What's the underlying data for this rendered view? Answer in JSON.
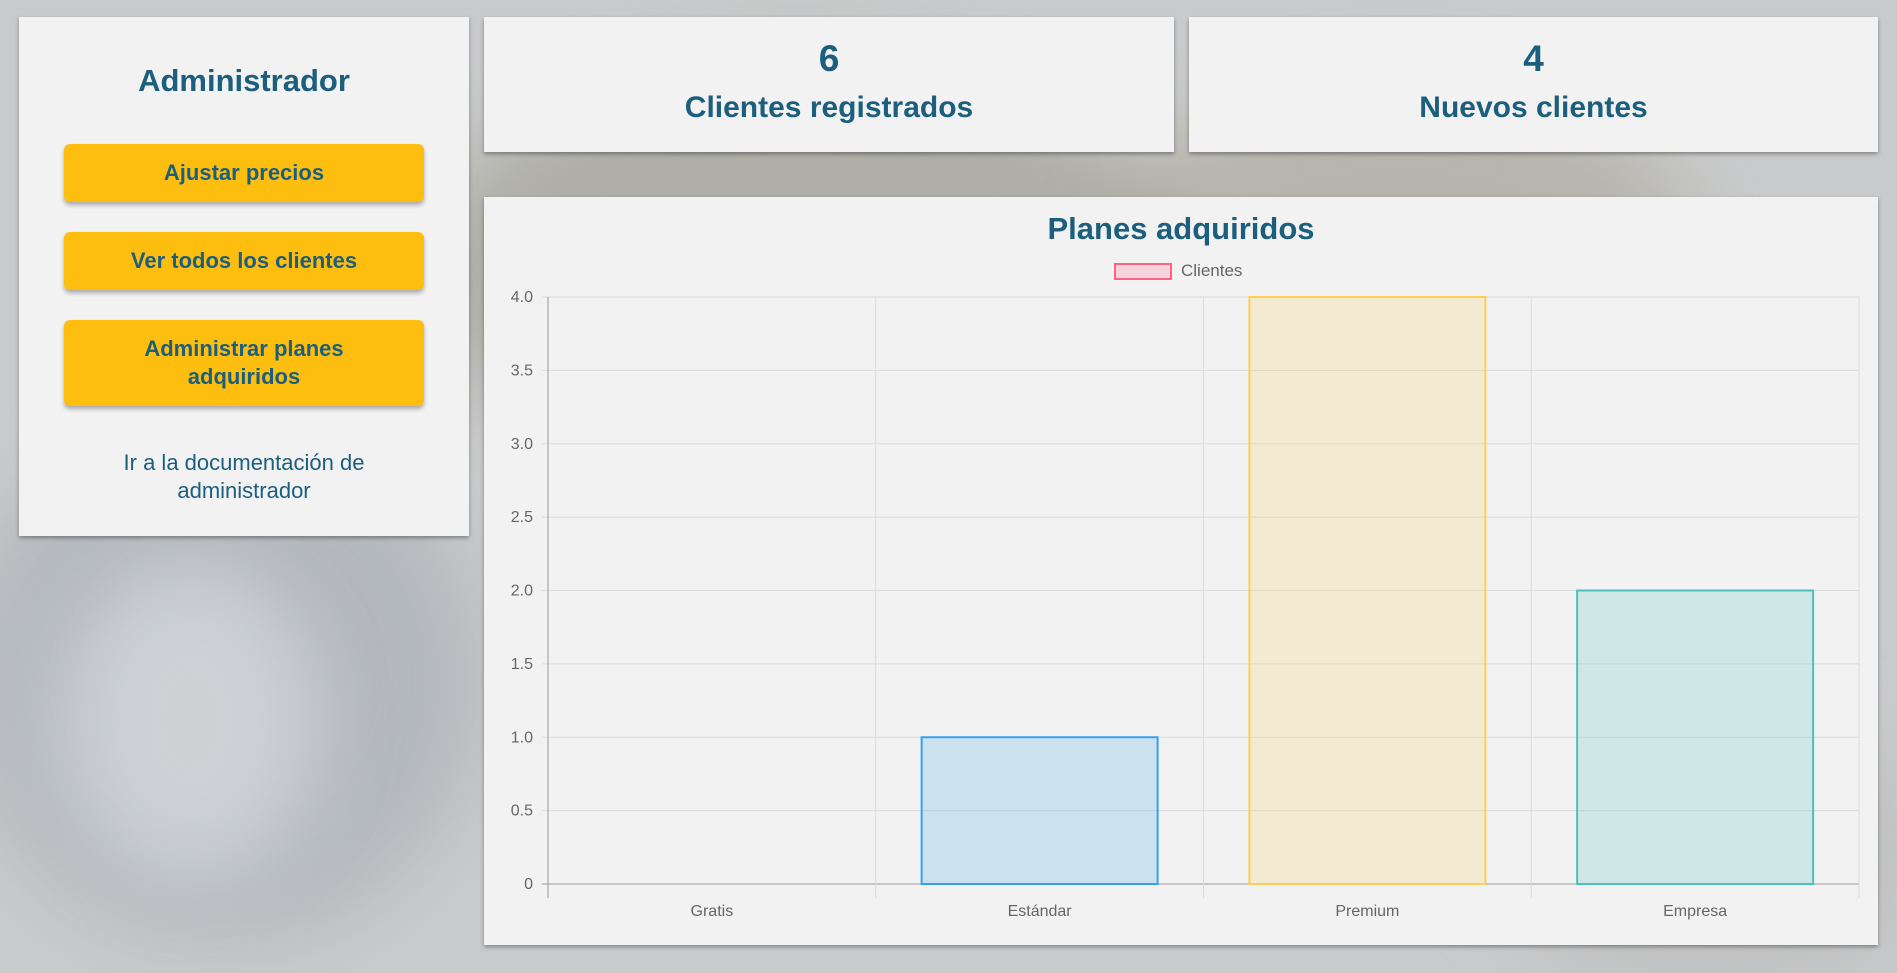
{
  "admin": {
    "title": "Administrador",
    "buttons": [
      "Ajustar precios",
      "Ver todos los clientes",
      "Administrar planes adquiridos"
    ],
    "doc_link": "Ir a la documentación de administrador"
  },
  "stats": [
    {
      "value": "6",
      "label": "Clientes registrados"
    },
    {
      "value": "4",
      "label": "Nuevos clientes"
    }
  ],
  "colors": {
    "accent": "#fdbe10",
    "text": "#1b5e7d",
    "card": "#f2f2f2"
  },
  "chart_data": {
    "type": "bar",
    "title": "Planes adquiridos",
    "categories": [
      "Gratis",
      "Estándar",
      "Premium",
      "Empresa"
    ],
    "series": [
      {
        "name": "Clientes",
        "values": [
          0,
          1,
          4,
          2
        ]
      }
    ],
    "bar_fill": [
      "rgba(255,99,132,0.2)",
      "rgba(54,162,235,0.2)",
      "rgba(255,206,86,0.2)",
      "rgba(75,192,192,0.2)"
    ],
    "bar_border": [
      "rgba(255,99,132,1)",
      "rgba(54,162,235,1)",
      "rgba(255,206,86,1)",
      "rgba(75,192,192,1)"
    ],
    "ylim": [
      0,
      4
    ],
    "yticks": [
      "0",
      "0.5",
      "1.0",
      "1.5",
      "2.0",
      "2.5",
      "3.0",
      "3.5",
      "4.0"
    ],
    "xlabel": "",
    "ylabel": "",
    "grid": true,
    "legend": "top-center"
  }
}
